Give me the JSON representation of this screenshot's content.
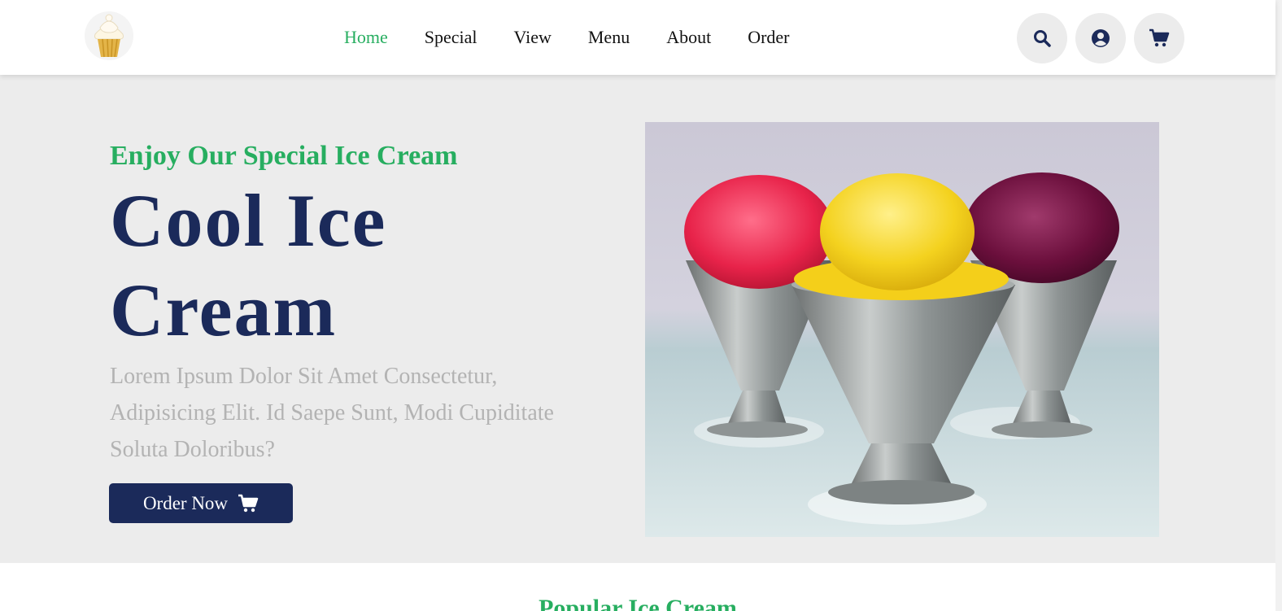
{
  "nav": {
    "links": [
      {
        "label": "Home",
        "active": true
      },
      {
        "label": "Special",
        "active": false
      },
      {
        "label": "View",
        "active": false
      },
      {
        "label": "Menu",
        "active": false
      },
      {
        "label": "About",
        "active": false
      },
      {
        "label": "Order",
        "active": false
      }
    ],
    "icons": [
      "search-icon",
      "user-icon",
      "cart-icon"
    ]
  },
  "hero": {
    "subtitle": "Enjoy Our Special Ice Cream",
    "title": "Cool Ice Cream",
    "description": "Lorem Ipsum Dolor Sit Amet Consectetur, Adipisicing Elit. Id Saepe Sunt, Modi Cupiditate Soluta Doloribus?",
    "button_label": "Order Now",
    "button_icon": "cart-icon"
  },
  "sections": {
    "popular_title": "Popular Ice Cream"
  },
  "colors": {
    "accent_green": "#27ae60",
    "navy": "#1b2a5a",
    "hero_bg": "#ececec",
    "muted_text": "#b3b3b3"
  }
}
